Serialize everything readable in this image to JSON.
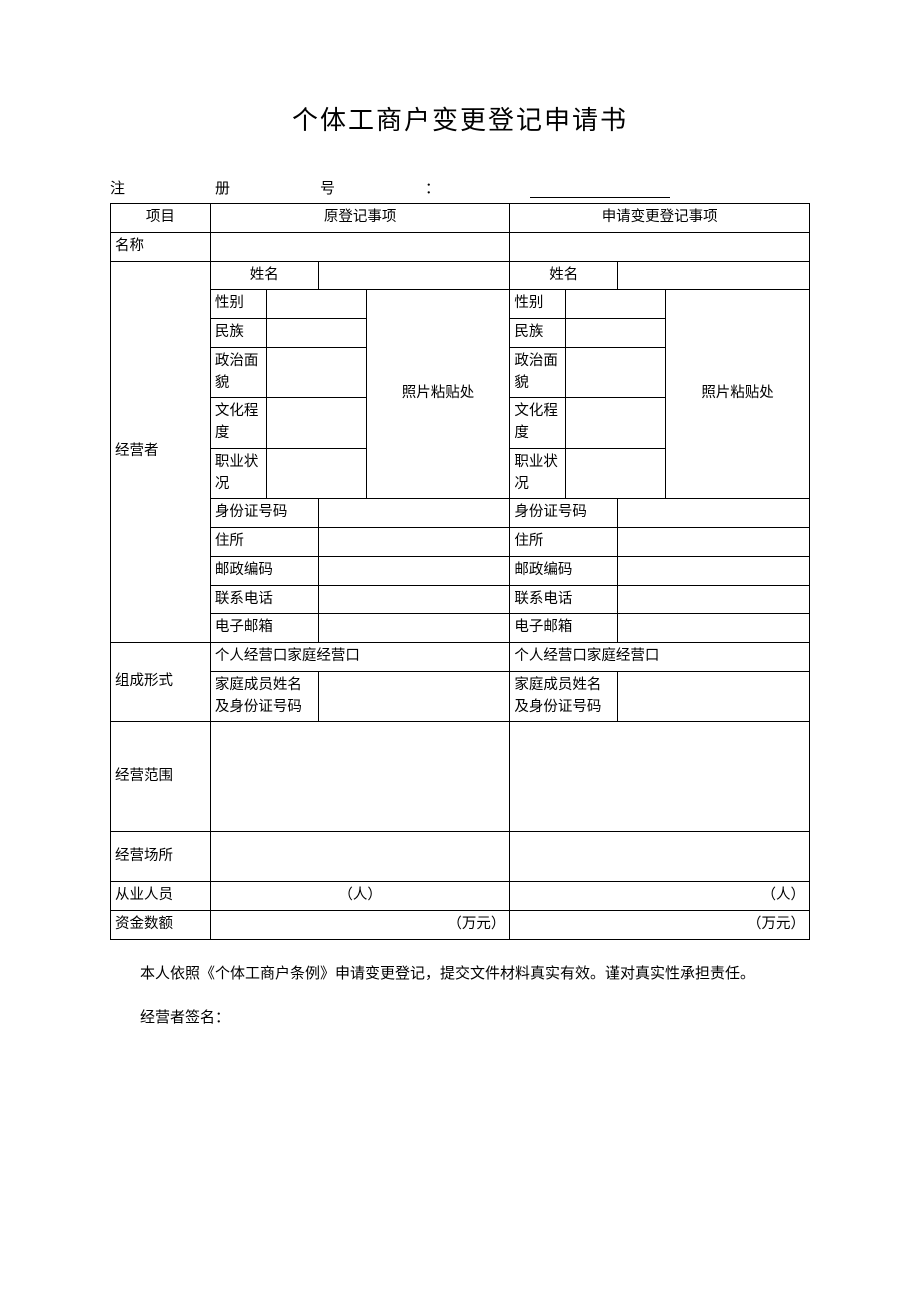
{
  "title": "个体工商户变更登记申请书",
  "reg": {
    "zhu": "注",
    "ce": "册",
    "hao": "号",
    "colon": "：",
    "value": ""
  },
  "headers": {
    "project": "项目",
    "original": "原登记事项",
    "change": "申请变更登记事项"
  },
  "rows": {
    "name": "名称",
    "operator": "经营者",
    "xingming": "姓名",
    "xingbie": "性别",
    "minzu": "民族",
    "zhengzhi": "政治面貌",
    "wenhua": "文化程度",
    "zhiye": "职业状况",
    "shenfen": "身份证号码",
    "zhuzhi": "住所",
    "youbian": "邮政编码",
    "dianhua": "联系电话",
    "email": "电子邮箱",
    "photo": "照片粘贴处",
    "zucheng": "组成形式",
    "jingying_type": "个人经营口家庭经营口",
    "jiating": "家庭成员姓名及身份证号码",
    "fanwei": "经营范围",
    "changsuo": "经营场所",
    "congye": "从业人员",
    "ren": "（人）",
    "zijin": "资金数额",
    "wanyuan": "（万元）"
  },
  "footer": {
    "statement": "本人依照《个体工商户条例》申请变更登记，提交文件材料真实有效。谨对真实性承担责任。",
    "sign": "经营者签名："
  }
}
